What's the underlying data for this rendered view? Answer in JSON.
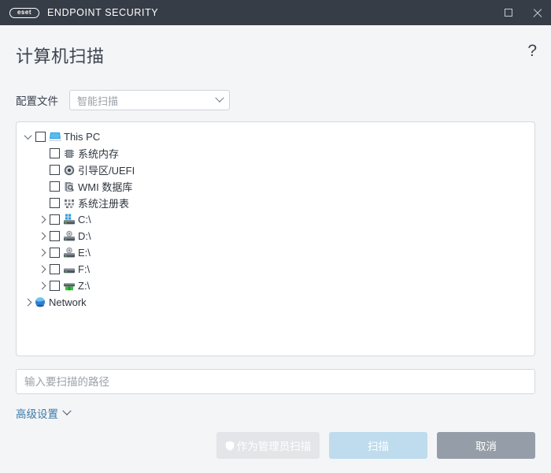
{
  "titlebar": {
    "logo_text": "eset",
    "app_name": "ENDPOINT SECURITY",
    "maximize_label": "",
    "close_label": ""
  },
  "header": {
    "title": "计算机扫描",
    "help_glyph": "?"
  },
  "profile": {
    "label": "配置文件",
    "selected": "智能扫描",
    "options": [
      "智能扫描"
    ]
  },
  "tree": {
    "nodes": [
      {
        "label": "This PC",
        "icon": "computer-icon",
        "level": 1,
        "expander": "expanded",
        "checked": false
      },
      {
        "label": "系统内存",
        "icon": "memory-icon",
        "level": 2,
        "expander": "none",
        "checked": false
      },
      {
        "label": "引导区/UEFI",
        "icon": "boot-sector-icon",
        "level": 2,
        "expander": "none",
        "checked": false
      },
      {
        "label": "WMI 数据库",
        "icon": "wmi-icon",
        "level": 2,
        "expander": "none",
        "checked": false
      },
      {
        "label": "系统注册表",
        "icon": "registry-icon",
        "level": 2,
        "expander": "none",
        "checked": false
      },
      {
        "label": "C:\\",
        "icon": "system-drive-icon",
        "level": 2,
        "expander": "collapsed",
        "checked": false
      },
      {
        "label": "D:\\",
        "icon": "optical-drive-icon",
        "level": 2,
        "expander": "collapsed",
        "checked": false
      },
      {
        "label": "E:\\",
        "icon": "optical-drive-icon",
        "level": 2,
        "expander": "collapsed",
        "checked": false
      },
      {
        "label": "F:\\",
        "icon": "hard-drive-icon",
        "level": 2,
        "expander": "collapsed",
        "checked": false
      },
      {
        "label": "Z:\\",
        "icon": "network-drive-icon",
        "level": 2,
        "expander": "collapsed",
        "checked": false
      },
      {
        "label": "Network",
        "icon": "network-icon",
        "level": 1,
        "expander": "collapsed",
        "checked": null
      }
    ]
  },
  "path_field": {
    "placeholder": "输入要扫描的路径",
    "value": ""
  },
  "advanced": {
    "label": "高级设置"
  },
  "footer": {
    "scan_as_admin_label": "作为管理员扫描",
    "scan_label": "扫描",
    "cancel_label": "取消"
  },
  "colors": {
    "titlebar_bg": "#373d47",
    "page_bg": "#f4f5f7",
    "link": "#3b7aa8",
    "scan_button": "#bedcee",
    "cancel_button": "#959ea8",
    "admin_button": "#e3e5e8"
  }
}
